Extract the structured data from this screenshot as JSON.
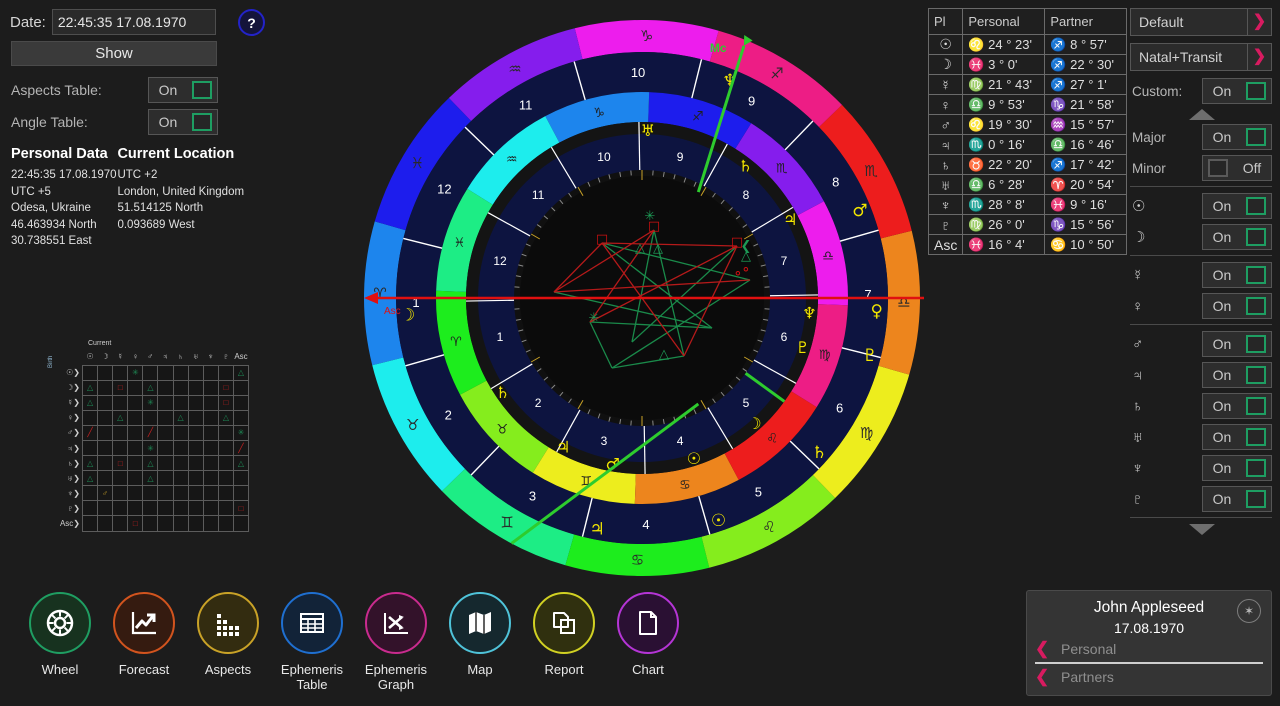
{
  "left": {
    "date_label": "Date:",
    "date_value": "22:45:35 17.08.1970",
    "help_label": "?",
    "show_label": "Show",
    "aspects_table_label": "Aspects Table:",
    "aspects_table_state": "On",
    "angle_table_label": "Angle Table:",
    "angle_table_state": "On",
    "personal_data_header": "Personal Data",
    "current_location_header": "Current Location",
    "personal_lines": [
      "22:45:35 17.08.1970",
      "UTC +5",
      "Odesa, Ukraine",
      "46.463934 North",
      "30.738551 East"
    ],
    "location_lines": [
      "UTC +2",
      "London, United Kingdom",
      "51.514125 North",
      "0.093689 West"
    ]
  },
  "aspect_grid": {
    "title": "Current",
    "side_label": "Birth",
    "columns": [
      "☉",
      "☽",
      "☿",
      "♀",
      "♂",
      "♃",
      "♄",
      "♅",
      "♆",
      "♇",
      "Asc"
    ],
    "rows": [
      "☉",
      "☽",
      "☿",
      "♀",
      "♂",
      "♃",
      "♄",
      "♅",
      "♆",
      "♇",
      "Asc"
    ],
    "cells": [
      [
        null,
        null,
        null,
        "sextile",
        null,
        null,
        null,
        null,
        null,
        null,
        "trine"
      ],
      [
        "trine",
        null,
        "square",
        null,
        "trine",
        null,
        null,
        null,
        null,
        "square",
        null
      ],
      [
        "trine",
        null,
        null,
        null,
        "sextile",
        null,
        null,
        null,
        null,
        "square",
        null
      ],
      [
        null,
        null,
        "trine",
        null,
        null,
        null,
        "trine",
        null,
        null,
        "trine",
        null
      ],
      [
        "opposition",
        null,
        null,
        null,
        "opposition",
        null,
        null,
        null,
        null,
        null,
        "sextile"
      ],
      [
        null,
        null,
        null,
        null,
        "sextile",
        null,
        null,
        null,
        null,
        null,
        "opposition"
      ],
      [
        "trine",
        null,
        "square",
        null,
        "trine",
        null,
        null,
        null,
        null,
        null,
        "trine"
      ],
      [
        "trine",
        null,
        null,
        null,
        "trine",
        null,
        null,
        null,
        null,
        null,
        null
      ],
      [
        null,
        "conjunction",
        null,
        null,
        null,
        null,
        null,
        null,
        null,
        null,
        null
      ],
      [
        null,
        null,
        null,
        null,
        null,
        null,
        null,
        null,
        null,
        null,
        "square"
      ],
      [
        null,
        null,
        null,
        "square",
        null,
        null,
        null,
        null,
        null,
        null,
        null
      ]
    ]
  },
  "wheel": {
    "asc_label": "Asc",
    "mc_label": "Mc",
    "zodiac_signs": [
      "♈",
      "♉",
      "♊",
      "♋",
      "♌",
      "♍",
      "♎",
      "♏",
      "♐",
      "♑",
      "♒",
      "♓"
    ],
    "outer_house_numbers": [
      "1",
      "2",
      "3",
      "4",
      "5",
      "6",
      "7",
      "8",
      "9",
      "10",
      "11",
      "12"
    ],
    "inner_house_numbers": [
      "1",
      "2",
      "3",
      "4",
      "5",
      "6",
      "7",
      "8",
      "9",
      "10",
      "11",
      "12"
    ],
    "outer_planets": [
      {
        "glyph": "♆",
        "angle": 68
      },
      {
        "glyph": "♂",
        "angle": 22
      },
      {
        "glyph": "♀",
        "angle": -3
      },
      {
        "glyph": "♇",
        "angle": -14
      },
      {
        "glyph": "♄",
        "angle": -41
      },
      {
        "glyph": "☽",
        "angle": 184
      },
      {
        "glyph": "☉",
        "angle": -71
      },
      {
        "glyph": "♃",
        "angle": -101
      }
    ],
    "inner_planets": [
      {
        "glyph": "♅",
        "angle": 88
      },
      {
        "glyph": "♄",
        "angle": 52
      },
      {
        "glyph": "♃",
        "angle": 28
      },
      {
        "glyph": "♆",
        "angle": -5
      },
      {
        "glyph": "♇",
        "angle": -17
      },
      {
        "glyph": "☽",
        "angle": -48
      },
      {
        "glyph": "☉",
        "angle": -72
      },
      {
        "glyph": "♂",
        "angle": -100
      },
      {
        "glyph": "♃",
        "angle": -118
      },
      {
        "glyph": "♄",
        "angle": 214
      }
    ]
  },
  "planet_table": {
    "headers": [
      "Pl",
      "Personal",
      "Partner"
    ],
    "rows": [
      {
        "planet": "☉",
        "personal": "♌ 24 ° 23'",
        "partner": "♐ 8 ° 57'"
      },
      {
        "planet": "☽",
        "personal": "♓ 3 ° 0'",
        "partner": "♐ 22 ° 30'"
      },
      {
        "planet": "☿",
        "personal": "♍ 21 ° 43'",
        "partner": "♐ 27 ° 1'"
      },
      {
        "planet": "♀",
        "personal": "♎ 9 ° 53'",
        "partner": "♑ 21 ° 58'"
      },
      {
        "planet": "♂",
        "personal": "♌ 19 ° 30'",
        "partner": "♒ 15 ° 57'"
      },
      {
        "planet": "♃",
        "personal": "♏ 0 ° 16'",
        "partner": "♎ 16 ° 46'"
      },
      {
        "planet": "♄",
        "personal": "♉ 22 ° 20'",
        "partner": "♐ 17 ° 42'"
      },
      {
        "planet": "♅",
        "personal": "♎ 6 ° 28'",
        "partner": "♈ 20 ° 54'"
      },
      {
        "planet": "♆",
        "personal": "♏ 28 ° 8'",
        "partner": "♓ 9 ° 16'"
      },
      {
        "planet": "♇",
        "personal": "♍ 26 ° 0'",
        "partner": "♑ 15 ° 56'"
      },
      {
        "planet": "Asc",
        "personal": "♓ 16 ° 4'",
        "partner": "♋ 10 ° 50'"
      }
    ]
  },
  "right": {
    "preset_label": "Default",
    "chart_type_label": "Natal+Transit",
    "custom_label": "Custom:",
    "custom_state": "On",
    "major_label": "Major",
    "major_state": "On",
    "minor_label": "Minor",
    "minor_state": "Off",
    "planet_toggles": [
      {
        "glyph": "☉",
        "state": "On"
      },
      {
        "glyph": "☽",
        "state": "On"
      },
      {
        "glyph": "☿",
        "state": "On"
      },
      {
        "glyph": "♀",
        "state": "On"
      },
      {
        "glyph": "♂",
        "state": "On"
      },
      {
        "glyph": "♃",
        "state": "On"
      },
      {
        "glyph": "♄",
        "state": "On"
      },
      {
        "glyph": "♅",
        "state": "On"
      },
      {
        "glyph": "♆",
        "state": "On"
      },
      {
        "glyph": "♇",
        "state": "On"
      }
    ]
  },
  "nav": [
    {
      "label": "Wheel",
      "icon": "wheel-icon",
      "color": "#1f9e62",
      "bg": "#17321f"
    },
    {
      "label": "Forecast",
      "icon": "trend-up-icon",
      "color": "#d2541e",
      "bg": "#351b10"
    },
    {
      "label": "Aspects",
      "icon": "bar-steps-icon",
      "color": "#c9a227",
      "bg": "#332c10"
    },
    {
      "label": "Ephemeris Table",
      "icon": "table-grid-icon",
      "color": "#1f6fd0",
      "bg": "#122338"
    },
    {
      "label": "Ephemeris Graph",
      "icon": "shuffle-icon",
      "color": "#c92b8e",
      "bg": "#33122a"
    },
    {
      "label": "Map",
      "icon": "map-icon",
      "color": "#4fc3d9",
      "bg": "#15282e"
    },
    {
      "label": "Report",
      "icon": "copy-pages-icon",
      "color": "#d1d123",
      "bg": "#30300f"
    },
    {
      "label": "Chart",
      "icon": "document-icon",
      "color": "#b535d6",
      "bg": "#2a1033"
    }
  ],
  "profile": {
    "name": "John Appleseed",
    "date": "17.08.1970",
    "personal_label": "Personal",
    "partners_label": "Partners"
  },
  "colors": {
    "accent_pink": "#d81b60",
    "toggle_green": "#1e9e62",
    "asc_red": "#e01010",
    "mc_green": "#2ecc2e",
    "planet_yellow": "#f2e600"
  }
}
